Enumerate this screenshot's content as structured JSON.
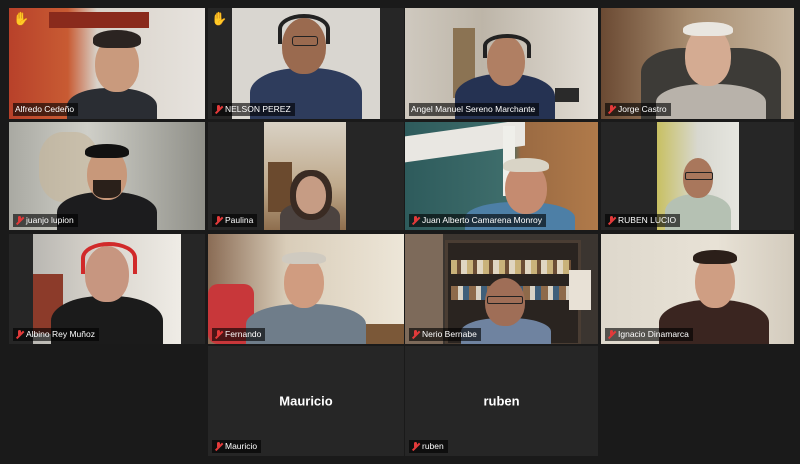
{
  "participants": [
    {
      "name": "Alfredo Cedeño",
      "muted": false,
      "hand_raised": true,
      "active_speaker": true
    },
    {
      "name": "NELSON PEREZ",
      "muted": true,
      "hand_raised": true
    },
    {
      "name": "Angel Manuel Sereno Marchante",
      "muted": false
    },
    {
      "name": "Jorge Castro",
      "muted": true
    },
    {
      "name": "juanjo lupion",
      "muted": true
    },
    {
      "name": "Paulina",
      "muted": true
    },
    {
      "name": "Juan Alberto Camarena Monroy",
      "muted": true
    },
    {
      "name": "RUBEN LUCIO",
      "muted": true
    },
    {
      "name": "Albino Rey Muñoz",
      "muted": true
    },
    {
      "name": "Fernando",
      "muted": true
    },
    {
      "name": "Nerio Bernabe",
      "muted": true
    },
    {
      "name": "Ignacio Dinamarca",
      "muted": true
    },
    {
      "name": "Mauricio",
      "muted": true,
      "video_off": true
    },
    {
      "name": "ruben",
      "muted": true,
      "video_off": true
    }
  ],
  "icons": {
    "hand": "raised-hand-icon",
    "mic": "muted-mic-icon"
  },
  "colors": {
    "active_border": "#c6e66a",
    "mute_icon": "#e23a3a",
    "tile_bg": "#262626",
    "hand": "#f7c531"
  }
}
